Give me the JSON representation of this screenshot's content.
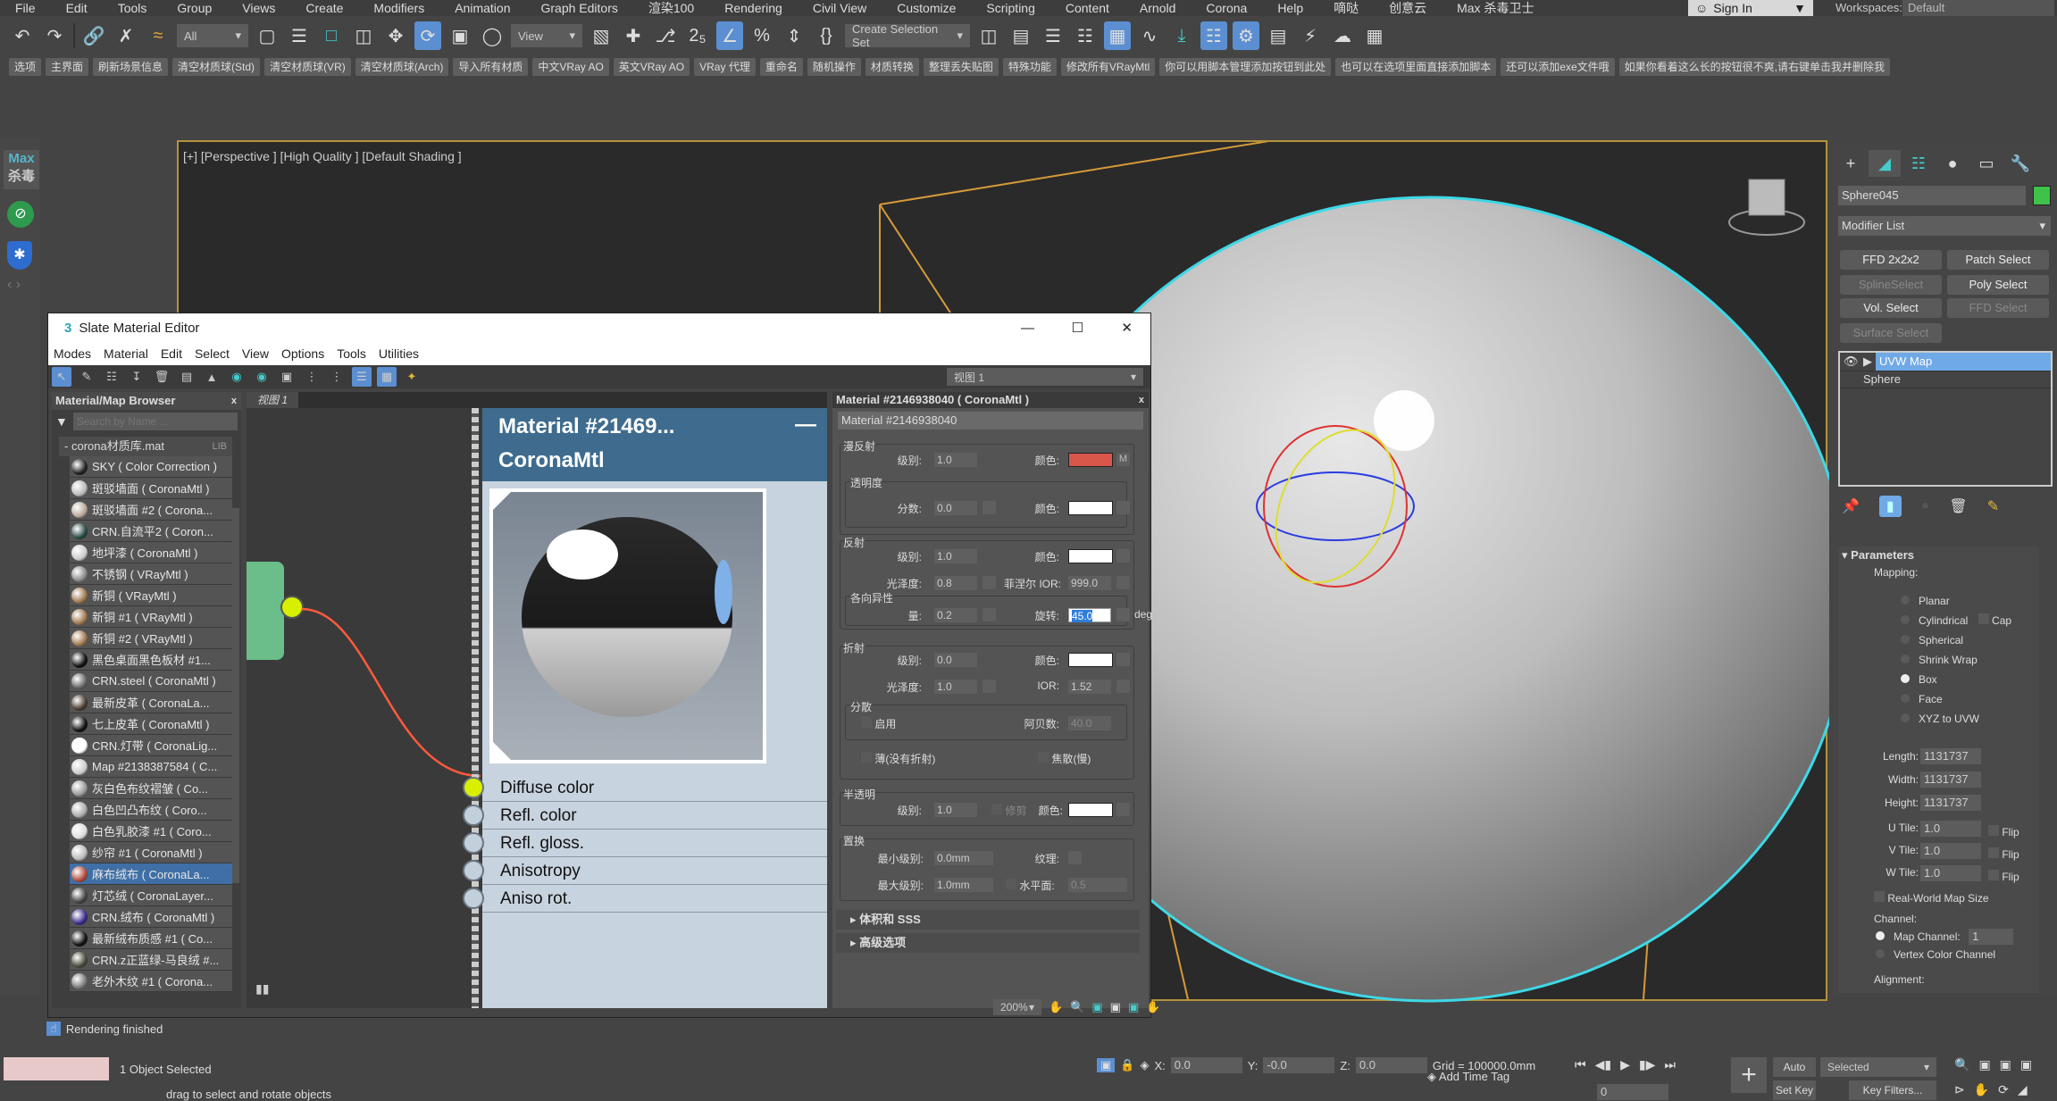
{
  "menubar": {
    "items": [
      "File",
      "Edit",
      "Tools",
      "Group",
      "Views",
      "Create",
      "Modifiers",
      "Animation",
      "Graph Editors",
      "渲染100",
      "Rendering",
      "Civil View",
      "Customize",
      "Scripting",
      "Content",
      "Arnold",
      "Corona",
      "Help",
      "嘀哒",
      "创意云",
      "Max 杀毒卫士"
    ],
    "sign_in": "Sign In",
    "workspaces_label": "Workspaces:",
    "workspace_value": "Default"
  },
  "toolbar": {
    "selection_filter": "All",
    "ref_coord": "View",
    "selection_set_placeholder": "Create Selection Set"
  },
  "cn_toolbar": {
    "buttons": [
      "选项",
      "主界面",
      "刷新场景信息",
      "清空材质球(Std)",
      "清空材质球(VR)",
      "清空材质球(Arch)",
      "导入所有材质",
      "中文VRay AO",
      "英文VRay AO",
      "VRay 代理",
      "重命名",
      "随机操作",
      "材质转换",
      "整理丢失贴图",
      "特殊功能",
      "修改所有VRayMtl",
      "你可以用脚本管理添加按钮到此处",
      "也可以在选项里面直接添加脚本",
      "还可以添加exe文件哦",
      "如果你看着这么长的按钮很不爽,请右键单击我并删除我"
    ]
  },
  "left_strip": {
    "logo_top": "Max",
    "logo_bottom": "杀毒"
  },
  "viewport": {
    "label": "[+] [Perspective ] [High Quality ] [Default Shading ]"
  },
  "slate": {
    "title": "Slate Material Editor",
    "menu": [
      "Modes",
      "Material",
      "Edit",
      "Select",
      "View",
      "Options",
      "Tools",
      "Utilities"
    ],
    "view_select": "视图 1",
    "browser": {
      "title": "Material/Map Browser",
      "search_placeholder": "Search by Name ...",
      "library": "corona材质库.mat",
      "library_tag": "LIB",
      "items": [
        {
          "label": "SKY ( Color Correction )",
          "color": "#222"
        },
        {
          "label": "斑驳墙面 ( CoronaMtl )",
          "color": "#bbb"
        },
        {
          "label": "斑驳墙面 #2 ( Corona...",
          "color": "#b8a898"
        },
        {
          "label": "CRN.自流平2 ( Coron...",
          "color": "#2a4a45"
        },
        {
          "label": "地坪漆 ( CoronaMtl )",
          "color": "#ccc"
        },
        {
          "label": "不锈钢 ( VRayMtl )",
          "color": "#888"
        },
        {
          "label": "新铜 ( VRayMtl )",
          "color": "#a07850"
        },
        {
          "label": "新铜 #1 ( VRayMtl )",
          "color": "#a07850"
        },
        {
          "label": "新铜 #2 ( VRayMtl )",
          "color": "#a07850"
        },
        {
          "label": "黑色桌面黑色板材 #1...",
          "color": "#111"
        },
        {
          "label": "CRN.steel ( CoronaMtl )",
          "color": "#666"
        },
        {
          "label": "最新皮革 ( CoronaLa...",
          "color": "#4a3a30"
        },
        {
          "label": "七上皮革 ( CoronaMtl )",
          "color": "#111"
        },
        {
          "label": "CRN.灯带 ( CoronaLig...",
          "color": "#fff"
        },
        {
          "label": "Map #2138387584 ( C...",
          "color": "#ccc"
        },
        {
          "label": "灰白色布纹褶皱 ( Co...",
          "color": "#999"
        },
        {
          "label": "白色凹凸布纹 ( Coro...",
          "color": "#aaa"
        },
        {
          "label": "白色乳胶漆 #1 ( Coro...",
          "color": "#ddd"
        },
        {
          "label": "纱帘 #1 ( CoronaMtl )",
          "color": "#bbb"
        },
        {
          "label": "麻布绒布 ( CoronaLa...",
          "color": "#b04a3a",
          "selected": true
        },
        {
          "label": "灯芯绒 ( CoronaLayer...",
          "color": "#444"
        },
        {
          "label": "CRN.绒布 ( CoronaMtl )",
          "color": "#3a2a8a"
        },
        {
          "label": "最新绒布质感 #1 ( Co...",
          "color": "#111"
        },
        {
          "label": "CRN.z正蓝绿-马良绒 #...",
          "color": "#4a4a3a"
        },
        {
          "label": "老外木纹 #1 ( Corona...",
          "color": "#777"
        }
      ]
    },
    "view_tab": "视图 1",
    "node": {
      "title_line1": "Material  #21469...",
      "title_line2": "CoronaMtl",
      "slots": [
        "Diffuse color",
        "Refl. color",
        "Refl. gloss.",
        "Anisotropy",
        "Aniso rot."
      ]
    },
    "zoom_level": "200%",
    "params": {
      "header": "Material #2146938040  ( CoronaMtl )",
      "name_field": "Material #2146938040",
      "diffuse": {
        "title": "漫反射",
        "level_label": "级别:",
        "level": "1.0",
        "color_label": "颜色:",
        "color": "#d9574a",
        "map_btn": "M"
      },
      "opacity": {
        "title": "透明度",
        "fraction_label": "分数:",
        "fraction": "0.0",
        "color_label": "颜色:",
        "color": "#ffffff"
      },
      "reflect": {
        "title": "反射",
        "level_label": "级别:",
        "level": "1.0",
        "color_label": "颜色:",
        "color": "#ffffff",
        "gloss_label": "光泽度:",
        "gloss": "0.8",
        "ior_label": "菲涅尔 IOR:",
        "ior": "999.0"
      },
      "aniso": {
        "title": "各向异性",
        "amount_label": "量:",
        "amount": "0.2",
        "rot_label": "旋转:",
        "rot": "45.0",
        "unit": "deg"
      },
      "refract": {
        "title": "折射",
        "level_label": "级别:",
        "level": "0.0",
        "color_label": "颜色:",
        "color": "#ffffff",
        "gloss_label": "光泽度:",
        "gloss": "1.0",
        "ior_label": "IOR:",
        "ior": "1.52"
      },
      "dispersion": {
        "title": "分散",
        "enable_label": "启用",
        "abbe_label": "阿贝数:",
        "abbe": "40.0"
      },
      "thin_label": "薄(没有折射)",
      "caustics_label": "焦散(慢)",
      "translucency": {
        "title": "半透明",
        "level_label": "级别:",
        "level": "1.0",
        "clip_label": "修剪",
        "color_label": "颜色:",
        "color": "#ffffff"
      },
      "displace": {
        "title": "置换",
        "min_label": "最小级别:",
        "min": "0.0mm",
        "tex_label": "纹理:",
        "max_label": "最大级别:",
        "max": "1.0mm",
        "water_label": "水平面:",
        "water": "0.5"
      },
      "rollouts": [
        "体积和 SSS",
        "高级选项"
      ]
    }
  },
  "cmdpanel": {
    "object_name": "Sphere045",
    "object_color": "#3fc24a",
    "modifier_list": "Modifier List",
    "mod_buttons": [
      {
        "label": "FFD 2x2x2",
        "enabled": true
      },
      {
        "label": "Patch Select",
        "enabled": true
      },
      {
        "label": "SplineSelect",
        "enabled": false
      },
      {
        "label": "Poly Select",
        "enabled": true
      },
      {
        "label": "Vol. Select",
        "enabled": true
      },
      {
        "label": "FFD Select",
        "enabled": false
      },
      {
        "label": "Surface Select",
        "enabled": false
      }
    ],
    "stack": [
      "UVW Map",
      "Sphere"
    ],
    "parameters_title": "Parameters",
    "mapping_label": "Mapping:",
    "mapping_options": [
      "Planar",
      "Cylindrical",
      "Spherical",
      "Shrink Wrap",
      "Box",
      "Face",
      "XYZ to UVW"
    ],
    "mapping_selected": "Box",
    "cap_label": "Cap",
    "length_label": "Length:",
    "length": "1131737",
    "width_label": "Width:",
    "width": "1131737",
    "height_label": "Height:",
    "height": "1131737",
    "utile_label": "U Tile:",
    "utile": "1.0",
    "vtile_label": "V Tile:",
    "vtile": "1.0",
    "wtile_label": "W Tile:",
    "wtile": "1.0",
    "flip_label": "Flip",
    "realworld_label": "Real-World Map Size",
    "channel_label": "Channel:",
    "map_channel_label": "Map Channel:",
    "map_channel": "1",
    "vertex_channel_label": "Vertex Color Channel",
    "alignment_label": "Alignment:"
  },
  "status": {
    "render_msg": "Rendering finished",
    "selected": "1 Object Selected",
    "hint": "drag to select and rotate objects",
    "x_label": "X:",
    "x": "0.0",
    "y_label": "Y:",
    "y": "-0.0",
    "z_label": "Z:",
    "z": "0.0",
    "grid": "Grid = 100000.0mm",
    "add_time_tag": "Add Time Tag",
    "frame": "0",
    "auto_key": "Auto Key",
    "set_key": "Set Key",
    "key_mode": "Selected",
    "key_filters": "Key Filters..."
  }
}
